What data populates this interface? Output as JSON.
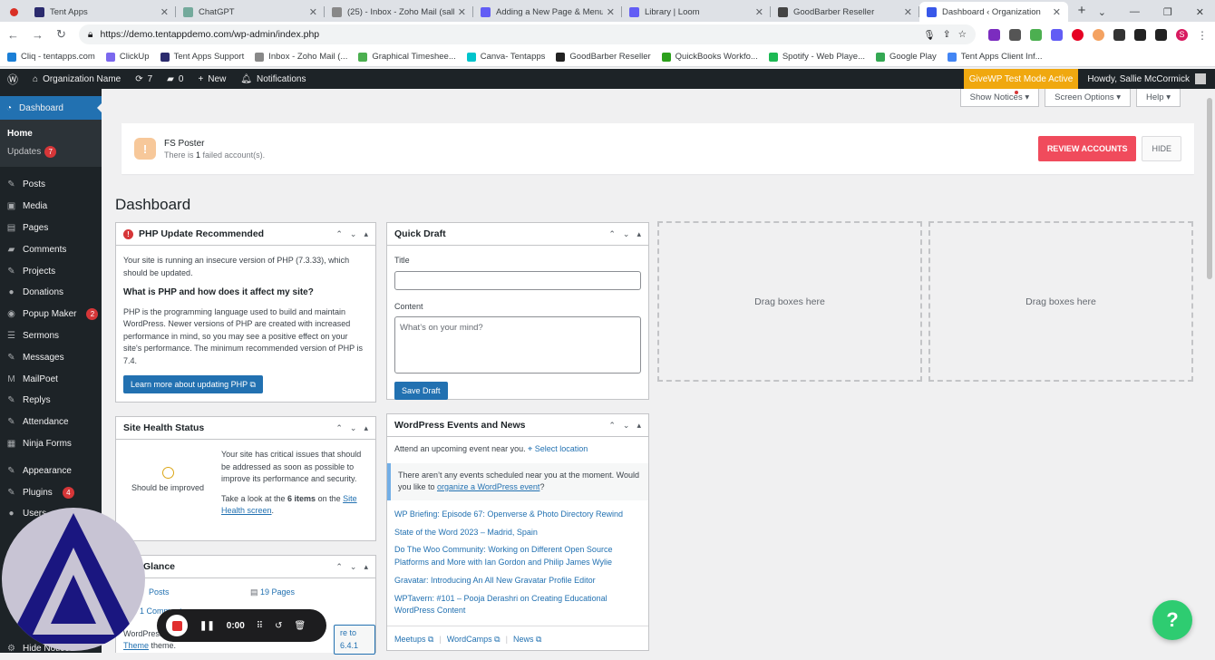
{
  "browser": {
    "tabs": [
      {
        "title": "Tent Apps",
        "color": "#2b2b6e"
      },
      {
        "title": "ChatGPT",
        "color": "#74aa9c"
      },
      {
        "title": "(25) - Inbox - Zoho Mail (sallie",
        "color": "#888888"
      },
      {
        "title": "Adding a New Page & Menu It",
        "color": "#625df5"
      },
      {
        "title": "Library | Loom",
        "color": "#625df5"
      },
      {
        "title": "GoodBarber Reseller",
        "color": "#444444"
      },
      {
        "title": "Dashboard ‹ Organization",
        "color": "#3858e9"
      }
    ],
    "url": "https://demo.tentappdemo.com/wp-admin/index.php",
    "profile_letter": "S",
    "bookmarks": [
      {
        "label": "Cliq - tentapps.com",
        "color": "#1b7fd6"
      },
      {
        "label": "ClickUp",
        "color": "#7b68ee"
      },
      {
        "label": "Tent Apps Support",
        "color": "#2b2b6e"
      },
      {
        "label": "Inbox - Zoho Mail (...",
        "color": "#888888"
      },
      {
        "label": "Graphical Timeshee...",
        "color": "#4caf50"
      },
      {
        "label": "Canva- Tentapps",
        "color": "#00c4cc"
      },
      {
        "label": "GoodBarber Reseller",
        "color": "#222222"
      },
      {
        "label": "QuickBooks Workfo...",
        "color": "#2ca01c"
      },
      {
        "label": "Spotify - Web Playe...",
        "color": "#1db954"
      },
      {
        "label": "Google Play",
        "color": "#34a853"
      },
      {
        "label": "Tent Apps Client Inf...",
        "color": "#4285f4"
      }
    ]
  },
  "adminbar": {
    "site_name": "Organization Name",
    "updates_count": "7",
    "comments_count": "0",
    "new_label": "New",
    "notifications_label": "Notifications",
    "givewp_label": "GiveWP Test Mode Active",
    "howdy": "Howdy, Sallie McCormick"
  },
  "sidebar": {
    "dashboard": "Dashboard",
    "home": "Home",
    "updates": "Updates",
    "updates_badge": "7",
    "items": [
      {
        "label": "Posts",
        "icon": "✎"
      },
      {
        "label": "Media",
        "icon": "▣"
      },
      {
        "label": "Pages",
        "icon": "▤"
      },
      {
        "label": "Comments",
        "icon": "▰"
      },
      {
        "label": "Projects",
        "icon": "✎"
      },
      {
        "label": "Donations",
        "icon": "●"
      },
      {
        "label": "Popup Maker",
        "icon": "◉",
        "badge": "2"
      },
      {
        "label": "Sermons",
        "icon": "☰"
      },
      {
        "label": "Messages",
        "icon": "✎"
      },
      {
        "label": "MailPoet",
        "icon": "M"
      },
      {
        "label": "Replys",
        "icon": "✎"
      },
      {
        "label": "Attendance",
        "icon": "✎"
      },
      {
        "label": "Ninja Forms",
        "icon": "▦"
      }
    ],
    "items2": [
      {
        "label": "Appearance",
        "icon": "✎"
      },
      {
        "label": "Plugins",
        "icon": "✎",
        "badge": "4"
      },
      {
        "label": "Users",
        "icon": "●"
      }
    ],
    "hide_notices": "Hide Notices"
  },
  "screen": {
    "show_notices": "Show Notices",
    "screen_options": "Screen Options",
    "help": "Help"
  },
  "notice": {
    "title": "FS Poster",
    "text_pre": "There is ",
    "count": "1",
    "text_post": " failed account(s).",
    "review": "REVIEW ACCOUNTS",
    "hide": "HIDE"
  },
  "page_title": "Dashboard",
  "php": {
    "title": "PHP Update Recommended",
    "p1": "Your site is running an insecure version of PHP (7.3.33), which should be updated.",
    "h": "What is PHP and how does it affect my site?",
    "p2": "PHP is the programming language used to build and maintain WordPress. Newer versions of PHP are created with increased performance in mind, so you may see a positive effect on your site's performance. The minimum recommended version of PHP is 7.4.",
    "btn": "Learn more about updating PHP"
  },
  "health": {
    "title": "Site Health Status",
    "status": "Should be improved",
    "p1": "Your site has critical issues that should be addressed as soon as possible to improve its performance and security.",
    "p2_pre": "Take a look at the ",
    "p2_items": "6 items",
    "p2_mid": " on the ",
    "p2_link": "Site Health screen",
    "p2_end": "."
  },
  "glance": {
    "title": "Glance",
    "posts": "Posts",
    "pages": "19 Pages",
    "comments": "1 Comment",
    "theme_line": "WordPress",
    "theme_link": "Theme",
    "theme_end": " theme.",
    "update_btn": "re to 6.4.1"
  },
  "quickdraft": {
    "title": "Quick Draft",
    "title_label": "Title",
    "content_label": "Content",
    "placeholder": "What’s on your mind?",
    "save": "Save Draft"
  },
  "events": {
    "title": "WordPress Events and News",
    "attend": "Attend an upcoming event near you.",
    "select_location": "Select location",
    "none_pre": "There aren’t any events scheduled near you at the moment. Would you like to ",
    "none_link": "organize a WordPress event",
    "none_end": "?",
    "news": [
      "WP Briefing: Episode 67: Openverse & Photo Directory Rewind",
      "State of the Word 2023 – Madrid, Spain",
      "Do The Woo Community: Working on Different Open Source Platforms and More with Ian Gordon and Philip James Wylie",
      "Gravatar: Introducing An All New Gravatar Profile Editor",
      "WPTavern: #101 – Pooja Derashri on Creating Educational WordPress Content"
    ],
    "meetups": "Meetups",
    "wordcamps": "WordCamps",
    "newslink": "News"
  },
  "drag1": "Drag boxes here",
  "drag2": "Drag boxes here",
  "recorder": {
    "time": "0:00"
  },
  "help_bubble": "?"
}
